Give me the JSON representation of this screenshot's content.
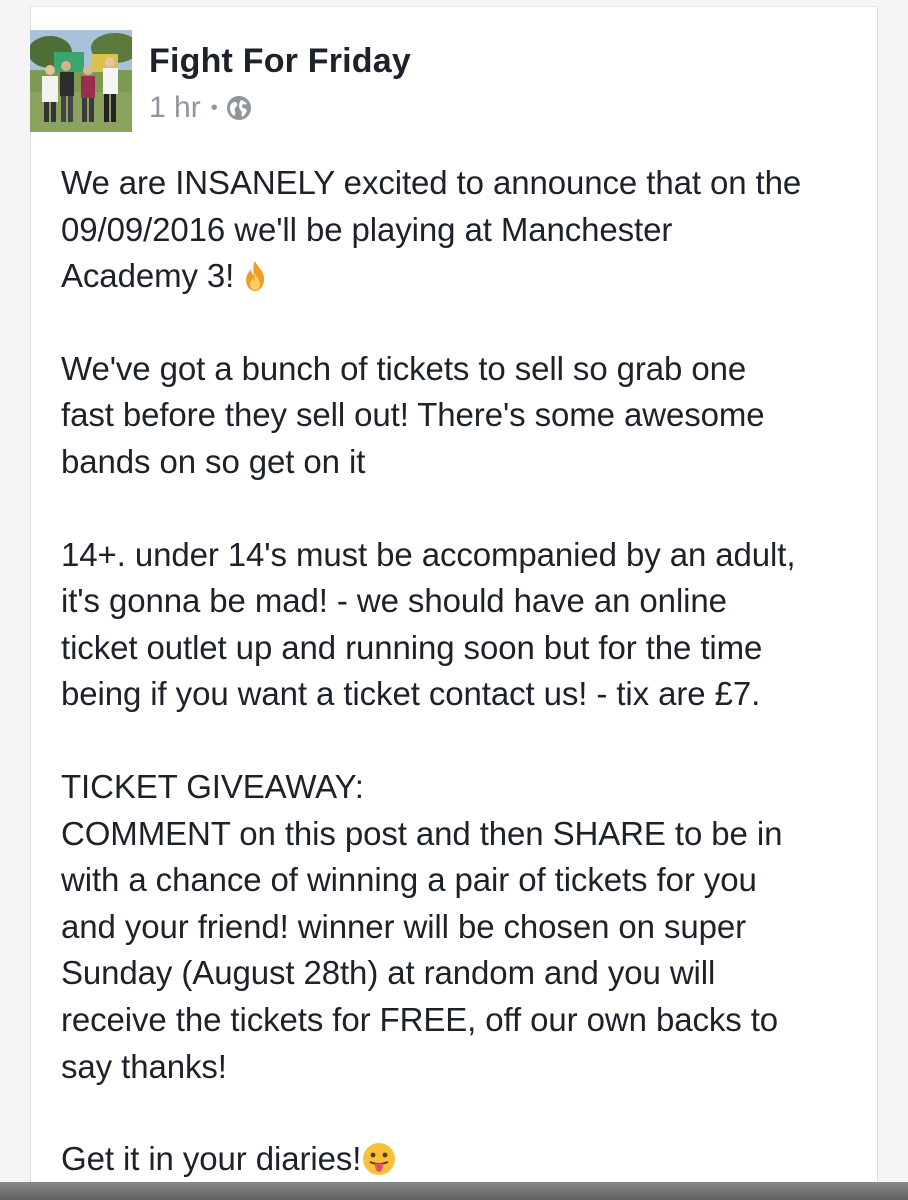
{
  "post": {
    "author": "Fight For Friday",
    "timestamp": "1 hr",
    "separator": "•",
    "privacy_icon": "globe-icon",
    "paragraphs": [
      "We are INSANELY excited to announce that on the\n09/09/2016 we'll be playing at Manchester\nAcademy 3!",
      "We've got a bunch of tickets to sell so grab one\nfast before they sell out! There's some awesome\nbands on so get on it",
      "14+. under 14's must be accompanied by an adult,\nit's gonna be mad! - we should have an online\nticket outlet up and running soon but for the time\nbeing if you want a ticket contact us! - tix are £7.",
      "TICKET GIVEAWAY:\nCOMMENT on this post and then SHARE to be in\nwith a chance of winning a pair of tickets for you\nand your friend! winner will be chosen on super\nSunday (August 28th) at random and you will\nreceive the tickets for FREE, off our own backs to\nsay thanks!",
      "Get it in your diaries!"
    ],
    "emojis": {
      "paragraph_1": "fire-emoji",
      "paragraph_5": "tongue-out-emoji"
    }
  },
  "colors": {
    "text_primary": "#1d2129",
    "text_meta": "#90949c",
    "card_border": "#dddfe2",
    "background": "#f5f5f5"
  }
}
